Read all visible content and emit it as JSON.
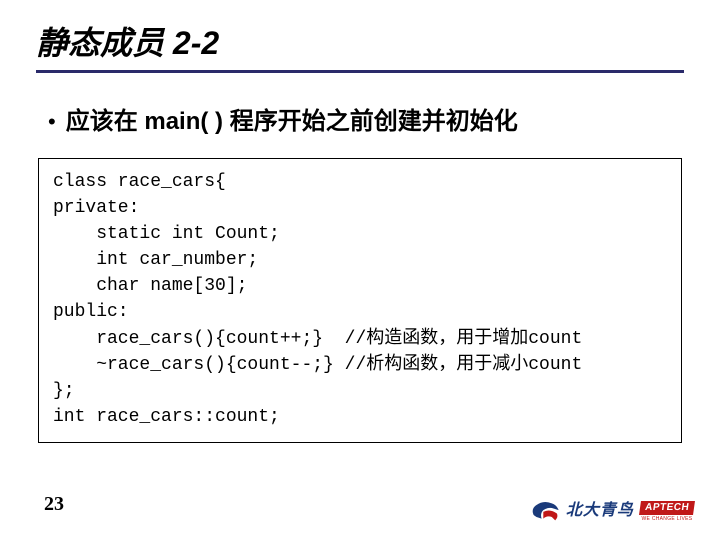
{
  "title": "静态成员 2-2",
  "bullet": "应该在 main( ) 程序开始之前创建并初始化",
  "code": {
    "l1": "class race_cars{",
    "l2": "private:",
    "l3": "    static int Count;",
    "l4": "    int car_number;",
    "l5": "    char name[30];",
    "l6": "public:",
    "l7": "    race_cars(){count++;}  //构造函数，用于增加count",
    "l8": "    ~race_cars(){count--;} //析构函数，用于减小count",
    "l9": "};",
    "l10": "int race_cars::count;"
  },
  "page_number": "23",
  "logo": {
    "cn": "北大青鸟",
    "aptech": "APTECH",
    "tagline": "WE CHANGE LIVES"
  }
}
